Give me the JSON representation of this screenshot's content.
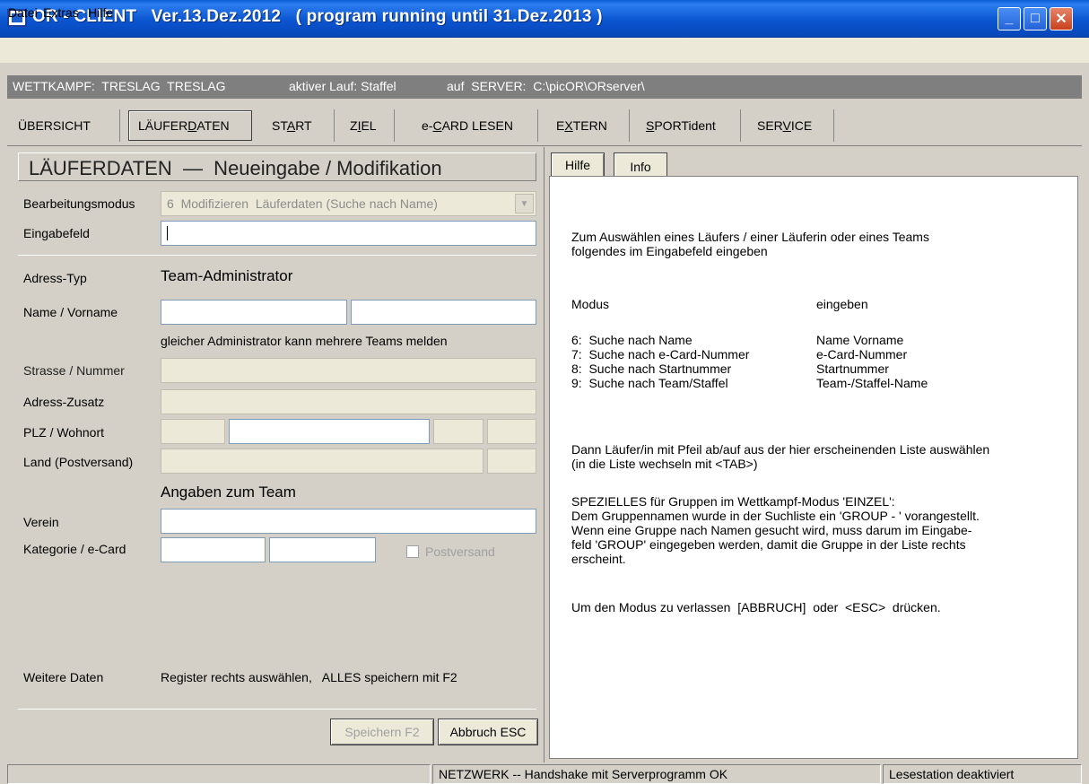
{
  "window": {
    "title": "OR - CLIENT   Ver.13.Dez.2012   ( program running until 31.Dez.2013 )",
    "min_glyph": "_",
    "max_glyph": "□",
    "close_glyph": "✕"
  },
  "menu": [
    "Datei",
    "Extras",
    "Hilfe"
  ],
  "server_bar": {
    "wettkampf": "WETTKAMPF:  TRESLAG  TRESLAG",
    "lauf": "aktiver Lauf: Staffel",
    "server": "auf  SERVER:  C:\\picOR\\ORserver\\"
  },
  "tabs": {
    "uebersicht": "ÜBERSICHT",
    "laeuferdaten_pre": "LÄUFER",
    "laeuferdaten_u": "D",
    "laeuferdaten_post": "ATEN",
    "start_pre": "ST",
    "start_u": "A",
    "start_post": "RT",
    "ziel_pre": "Z",
    "ziel_u": "I",
    "ziel_post": "EL",
    "ecard_pre": "e-",
    "ecard_u": "C",
    "ecard_post": "ARD LESEN",
    "extern_pre": "E",
    "extern_u": "X",
    "extern_post": "TERN",
    "sport_u": "S",
    "sport_post": "PORTident",
    "service_pre": "SER",
    "service_u": "V",
    "service_post": "ICE"
  },
  "left": {
    "header": "LÄUFERDATEN  —  Neueingabe / Modifikation",
    "bearbeitungsmodus_label": "Bearbeitungsmodus",
    "bearbeitungsmodus_value": "6  Modifizieren  Läuferdaten (Suche nach Name)",
    "eingabefeld_label": "Eingabefeld",
    "adress_typ_label": "Adress-Typ",
    "adress_typ_value": "Team-Administrator",
    "name_label": "Name / Vorname",
    "admin_hint": "gleicher Administrator kann mehrere Teams melden",
    "strasse_label": "Strasse / Nummer",
    "zusatz_label": "Adress-Zusatz",
    "plz_label": "PLZ / Wohnort",
    "land_label": "Land (Postversand)",
    "team_section": "Angaben zum Team",
    "verein_label": "Verein",
    "kategorie_label": "Kategorie / e-Card",
    "postversand_label": "Postversand",
    "weitere_label": "Weitere Daten",
    "weitere_hint": "Register rechts auswählen,   ALLES speichern mit F2",
    "save_button": "Speichern F2",
    "cancel_button": "Abbruch ESC"
  },
  "right": {
    "tab_hilfe": "Hilfe",
    "tab_info": "Info",
    "intro": "Zum Auswählen eines Läufers / einer Läuferin oder eines Teams\nfolgendes im Eingabefeld eingeben",
    "col_modus": "Modus",
    "col_eingeben": "eingeben",
    "modes": [
      {
        "mode": "6:  Suche nach Name",
        "input": "Name Vorname"
      },
      {
        "mode": "7:  Suche nach e-Card-Nummer",
        "input": "e-Card-Nummer"
      },
      {
        "mode": "8:  Suche nach Startnummer",
        "input": "Startnummer"
      },
      {
        "mode": "9:  Suche nach Team/Staffel",
        "input": "Team-/Staffel-Name"
      }
    ],
    "select_hint": "Dann Läufer/in mit Pfeil ab/auf aus der hier erscheinenden Liste auswählen\n(in die Liste wechseln mit <TAB>)",
    "special": "SPEZIELLES für Gruppen im Wettkampf-Modus 'EINZEL':\nDem Gruppennamen wurde in der Suchliste ein 'GROUP - ' vorangestellt.\nWenn eine Gruppe nach Namen gesucht wird, muss darum im Eingabe-\nfeld 'GROUP' eingegeben werden, damit die Gruppe in der Liste rechts\nerscheint.",
    "exit": "Um den Modus zu verlassen  [ABBRUCH]  oder  <ESC>  drücken."
  },
  "status": {
    "network": "NETZWERK -- Handshake mit Serverprogramm OK",
    "reader": "Lesestation deaktiviert"
  }
}
